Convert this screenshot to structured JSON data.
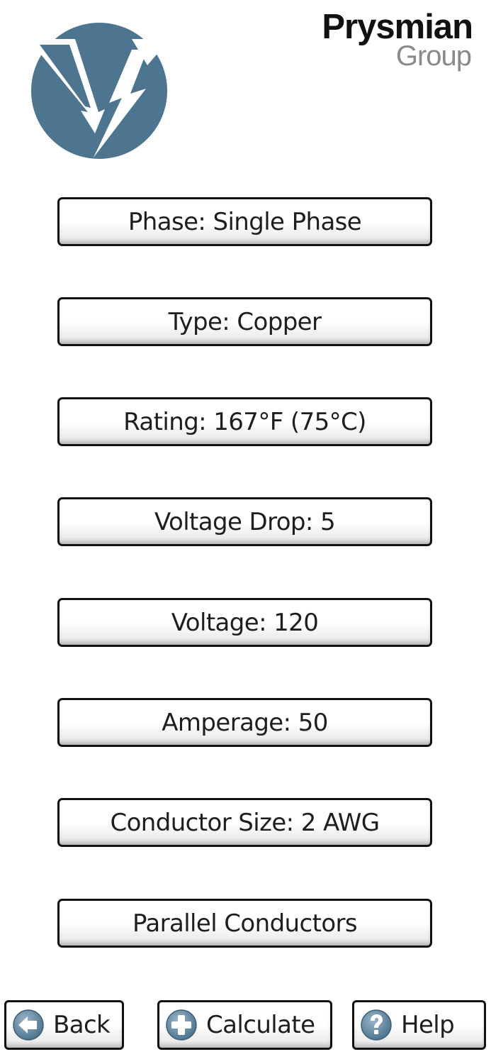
{
  "header": {
    "logo_icon": "voltage-drop-logo-icon",
    "brand_name": "Prysmian",
    "brand_sub": "Group",
    "logo_color": "#4e7590"
  },
  "options": [
    {
      "label": "Phase: Single Phase"
    },
    {
      "label": "Type: Copper"
    },
    {
      "label": "Rating: 167°F (75°C)"
    },
    {
      "label": "Voltage Drop: 5"
    },
    {
      "label": "Voltage: 120"
    },
    {
      "label": "Amperage: 50"
    },
    {
      "label": "Conductor Size: 2 AWG"
    },
    {
      "label": "Parallel Conductors"
    }
  ],
  "footer": {
    "back": {
      "label": "Back",
      "icon": "back-arrow-icon"
    },
    "calculate": {
      "label": "Calculate",
      "icon": "plus-circle-icon"
    },
    "help": {
      "label": "Help",
      "icon": "question-circle-icon"
    }
  }
}
